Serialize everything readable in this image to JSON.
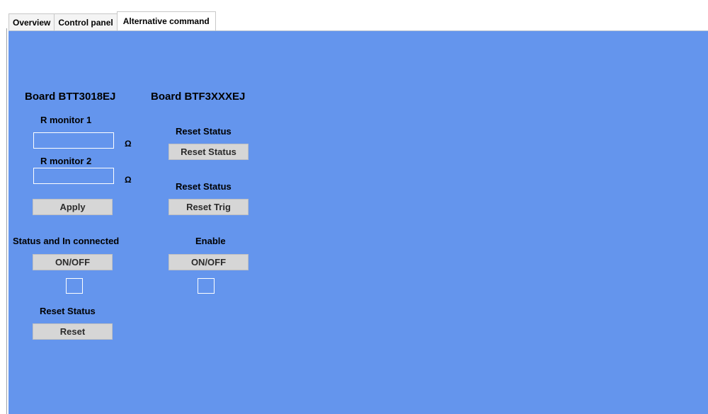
{
  "tabs": [
    "Overview",
    "Control panel",
    "Alternative command"
  ],
  "board_left": {
    "title": "Board BTT3018EJ",
    "r_monitor_1": {
      "label": "R monitor 1",
      "value": "",
      "unit": "Ω"
    },
    "r_monitor_2": {
      "label": "R monitor 2",
      "value": "",
      "unit": "Ω"
    },
    "apply_label": "Apply",
    "status_in_connected_label": "Status and In connected",
    "onoff_label": "ON/OFF",
    "reset_status_label": "Reset Status",
    "reset_label": "Reset"
  },
  "board_right": {
    "title": "Board BTF3XXXEJ",
    "reset_status_label_1": "Reset Status",
    "reset_status_button": "Reset Status",
    "reset_status_label_2": "Reset Status",
    "reset_trig_button": "Reset Trig",
    "enable_label": "Enable",
    "onoff_label": "ON/OFF"
  },
  "colors": {
    "page_background": "#6495ed",
    "button_background": "#d6d6d6"
  }
}
